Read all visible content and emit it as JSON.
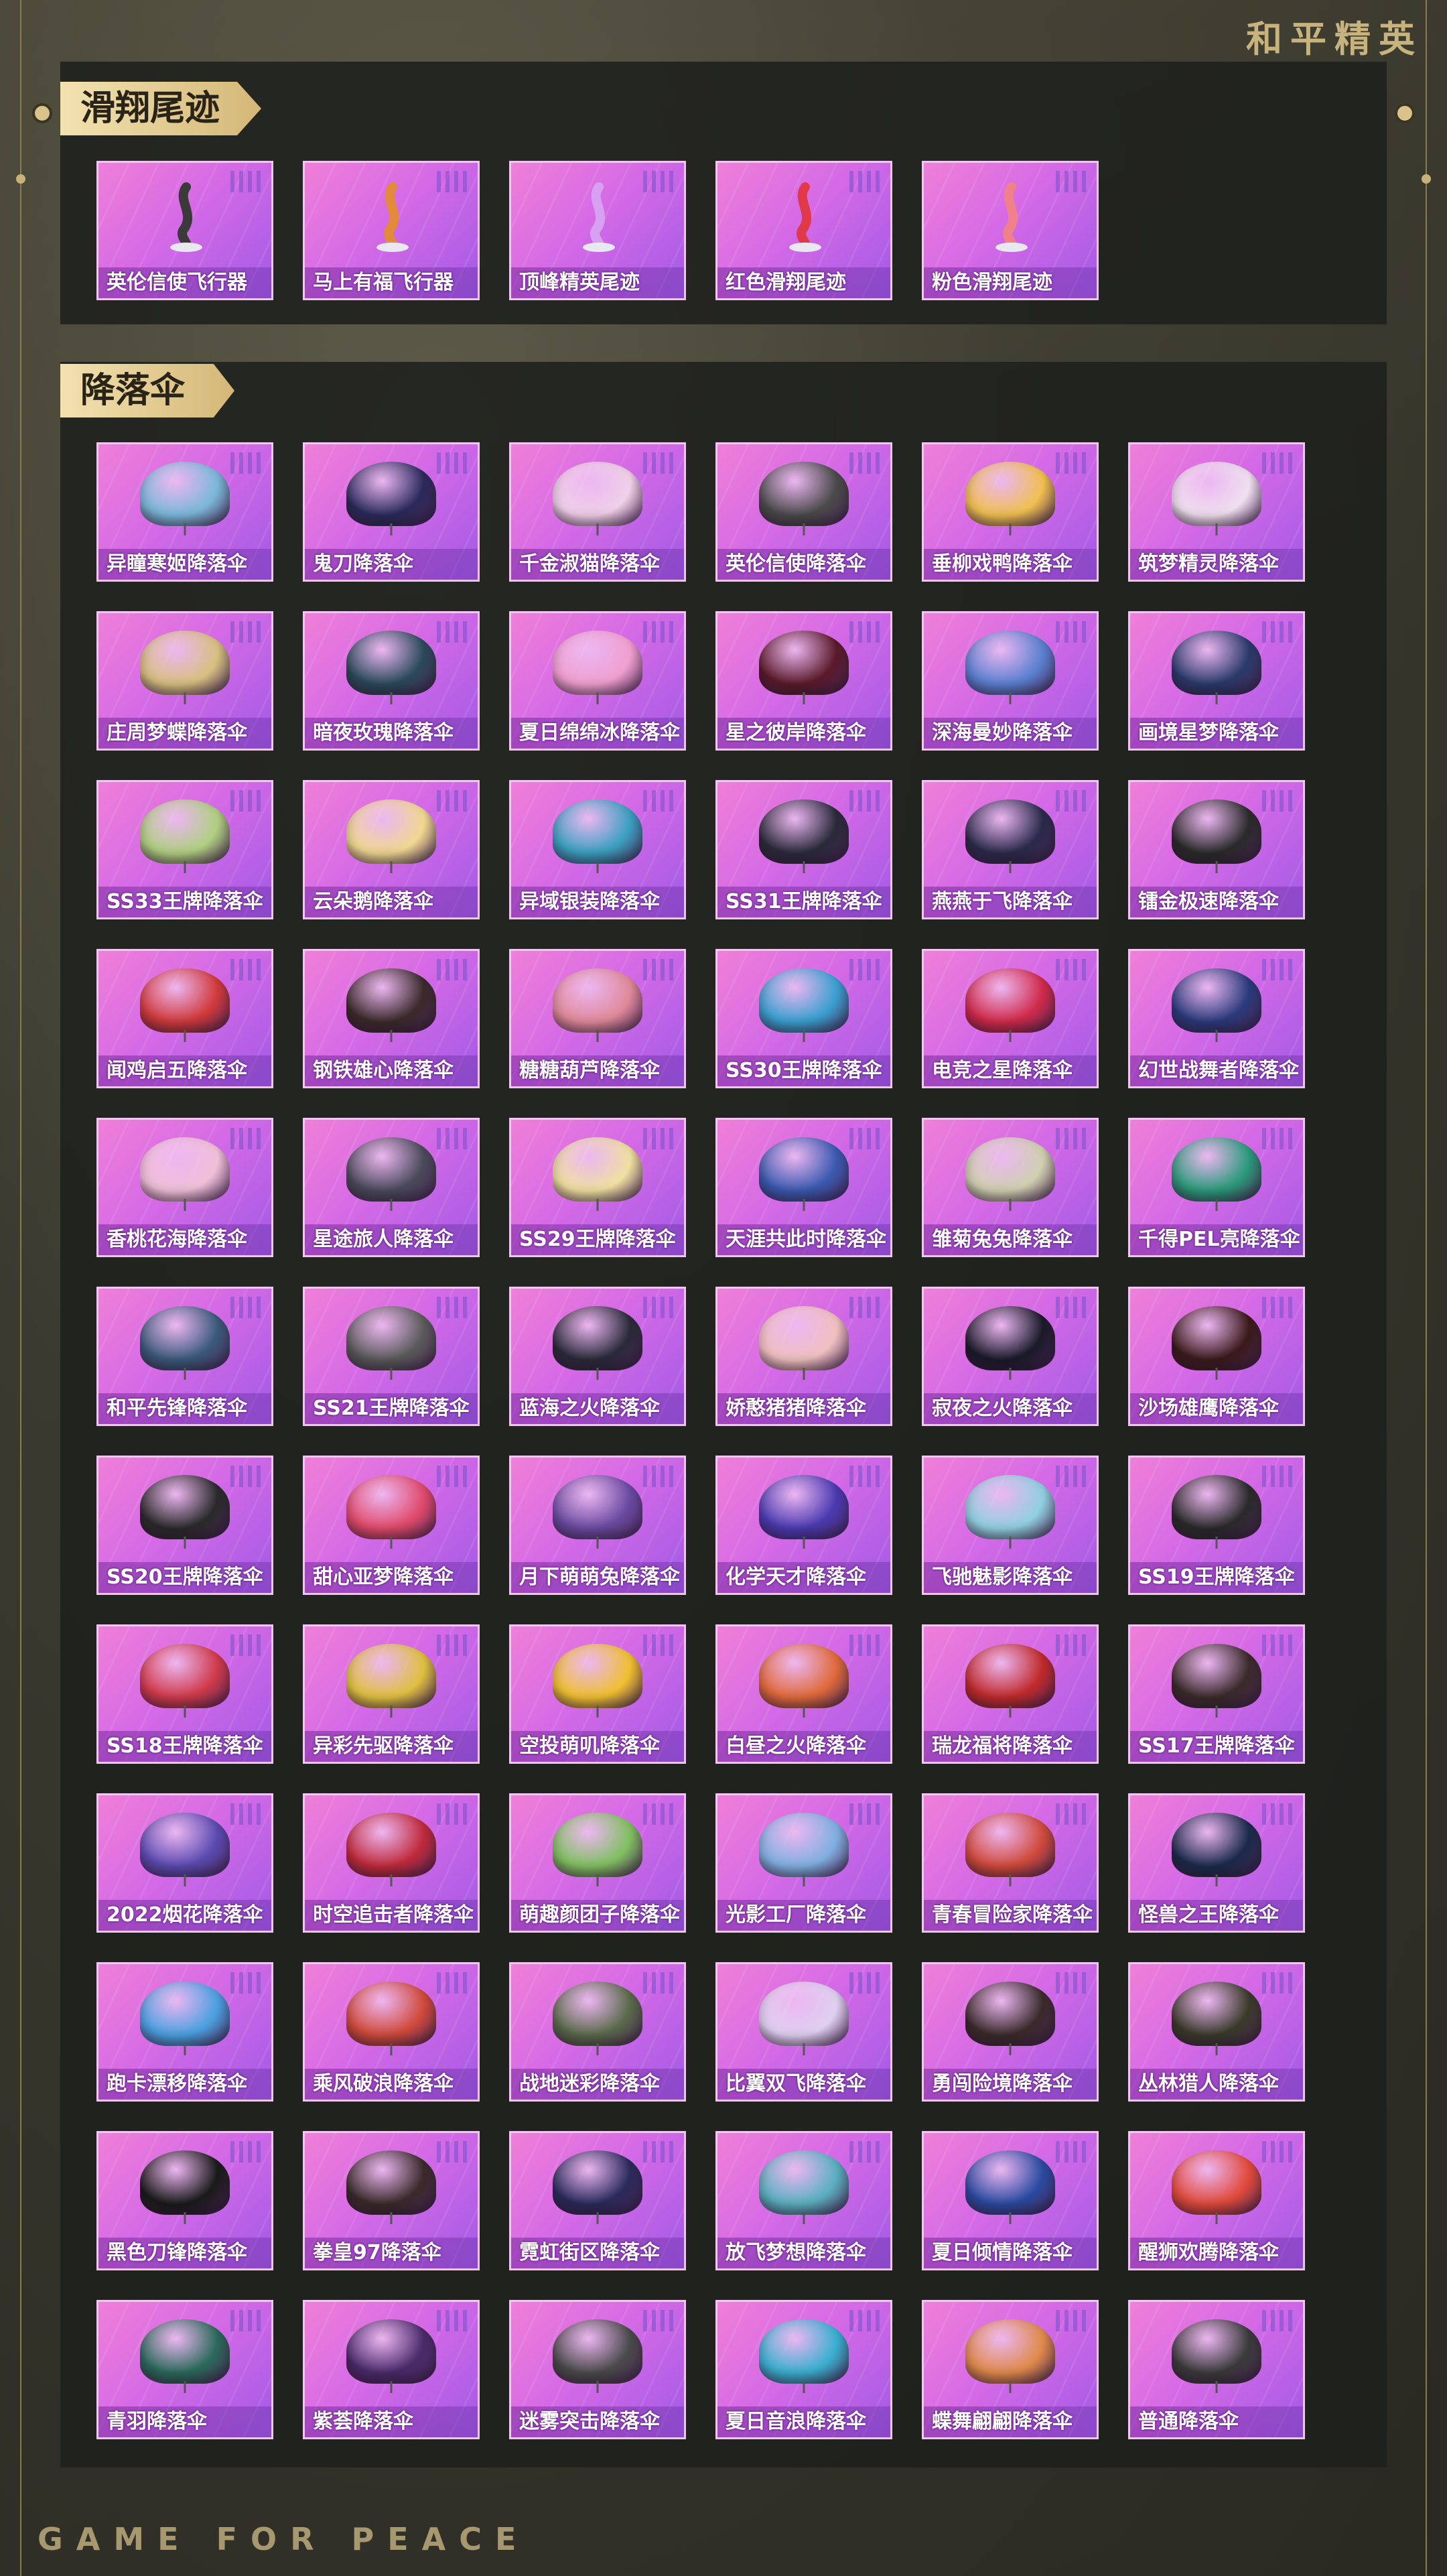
{
  "brand": "和平精英",
  "footer": "GAME FOR PEACE",
  "sections": {
    "trails": {
      "title": "滑翔尾迹",
      "items": [
        {
          "label": "英伦信使飞行器",
          "color": "#3a3a3a"
        },
        {
          "label": "马上有福飞行器",
          "color": "#e08a3a"
        },
        {
          "label": "顶峰精英尾迹",
          "color": "#d8a0f0"
        },
        {
          "label": "红色滑翔尾迹",
          "color": "#e03a4a"
        },
        {
          "label": "粉色滑翔尾迹",
          "color": "#f0808a"
        }
      ]
    },
    "parachutes": {
      "title": "降落伞",
      "items": [
        {
          "label": "异瞳寒姬降落伞",
          "color": "#7ab8d8"
        },
        {
          "label": "鬼刀降落伞",
          "color": "#2a2a5a"
        },
        {
          "label": "千金淑猫降落伞",
          "color": "#f0d0e8"
        },
        {
          "label": "英伦信使降落伞",
          "color": "#4a4a4a"
        },
        {
          "label": "垂柳戏鸭降落伞",
          "color": "#f0c050"
        },
        {
          "label": "筑梦精灵降落伞",
          "color": "#f0e0f0"
        },
        {
          "label": "庄周梦蝶降落伞",
          "color": "#d8c080"
        },
        {
          "label": "暗夜玫瑰降落伞",
          "color": "#2a4a5a"
        },
        {
          "label": "夏日绵绵冰降落伞",
          "color": "#f0a0d0"
        },
        {
          "label": "星之彼岸降落伞",
          "color": "#5a1a2a"
        },
        {
          "label": "深海曼妙降落伞",
          "color": "#5a80d0"
        },
        {
          "label": "画境星梦降落伞",
          "color": "#2a3a6a"
        },
        {
          "label": "SS33王牌降落伞",
          "color": "#b0d080"
        },
        {
          "label": "云朵鹅降落伞",
          "color": "#f0d890"
        },
        {
          "label": "异域银装降落伞",
          "color": "#3aa0c0"
        },
        {
          "label": "SS31王牌降落伞",
          "color": "#2a2a3a"
        },
        {
          "label": "燕燕于飞降落伞",
          "color": "#2a2a4a"
        },
        {
          "label": "镭金极速降落伞",
          "color": "#2a2a2a"
        },
        {
          "label": "闻鸡启五降落伞",
          "color": "#d03a3a"
        },
        {
          "label": "钢铁雄心降落伞",
          "color": "#3a2a2a"
        },
        {
          "label": "糖糖葫芦降落伞",
          "color": "#e08a9a"
        },
        {
          "label": "SS30王牌降落伞",
          "color": "#3aa0d0"
        },
        {
          "label": "电竞之星降落伞",
          "color": "#d02a4a"
        },
        {
          "label": "幻世战舞者降落伞",
          "color": "#2a3a7a"
        },
        {
          "label": "香桃花海降落伞",
          "color": "#f0c0d8"
        },
        {
          "label": "星途旅人降落伞",
          "color": "#4a4a5a"
        },
        {
          "label": "SS29王牌降落伞",
          "color": "#f0e0a0"
        },
        {
          "label": "天涯共此时降落伞",
          "color": "#3a5ab0"
        },
        {
          "label": "雏菊兔兔降落伞",
          "color": "#d0d0b0"
        },
        {
          "label": "千得PEL亮降落伞",
          "color": "#2a9a7a"
        },
        {
          "label": "和平先锋降落伞",
          "color": "#3a5a7a"
        },
        {
          "label": "SS21王牌降落伞",
          "color": "#5a5a5a"
        },
        {
          "label": "蓝海之火降落伞",
          "color": "#2a2a3a"
        },
        {
          "label": "娇憨猪猪降落伞",
          "color": "#f0c0c0"
        },
        {
          "label": "寂夜之火降落伞",
          "color": "#1a1a2a"
        },
        {
          "label": "沙场雄鹰降落伞",
          "color": "#3a1a1a"
        },
        {
          "label": "SS20王牌降落伞",
          "color": "#2a2a2a"
        },
        {
          "label": "甜心亚梦降落伞",
          "color": "#e04a6a"
        },
        {
          "label": "月下萌萌兔降落伞",
          "color": "#6a4aa0"
        },
        {
          "label": "化学天才降落伞",
          "color": "#4a3ab0"
        },
        {
          "label": "飞驰魅影降落伞",
          "color": "#90d0e0"
        },
        {
          "label": "SS19王牌降落伞",
          "color": "#2a2a2a"
        },
        {
          "label": "SS18王牌降落伞",
          "color": "#d03a4a"
        },
        {
          "label": "异彩先驱降落伞",
          "color": "#e0c040"
        },
        {
          "label": "空投萌叽降落伞",
          "color": "#f0c030"
        },
        {
          "label": "白昼之火降落伞",
          "color": "#e06a3a"
        },
        {
          "label": "瑞龙福将降落伞",
          "color": "#c02a2a"
        },
        {
          "label": "SS17王牌降落伞",
          "color": "#3a2a2a"
        },
        {
          "label": "2022烟花降落伞",
          "color": "#5a4ab0"
        },
        {
          "label": "时空追击者降落伞",
          "color": "#c02a3a"
        },
        {
          "label": "萌趣颜团子降落伞",
          "color": "#80c060"
        },
        {
          "label": "光影工厂降落伞",
          "color": "#80b0e0"
        },
        {
          "label": "青春冒险家降落伞",
          "color": "#d04a3a"
        },
        {
          "label": "怪兽之王降落伞",
          "color": "#1a2a4a"
        },
        {
          "label": "跑卡漂移降落伞",
          "color": "#4aa0e0"
        },
        {
          "label": "乘风破浪降落伞",
          "color": "#d04a3a"
        },
        {
          "label": "战地迷彩降落伞",
          "color": "#5a6a4a"
        },
        {
          "label": "比翼双飞降落伞",
          "color": "#e0d0f0"
        },
        {
          "label": "勇闯险境降落伞",
          "color": "#3a2a2a"
        },
        {
          "label": "丛林猎人降落伞",
          "color": "#3a3a2a"
        },
        {
          "label": "黑色刀锋降落伞",
          "color": "#1a1a1a"
        },
        {
          "label": "拳皇97降落伞",
          "color": "#3a2a2a"
        },
        {
          "label": "霓虹街区降落伞",
          "color": "#2a2a5a"
        },
        {
          "label": "放飞梦想降落伞",
          "color": "#5ab0c0"
        },
        {
          "label": "夏日倾情降落伞",
          "color": "#2a4aa0"
        },
        {
          "label": "醒狮欢腾降落伞",
          "color": "#e04a3a"
        },
        {
          "label": "青羽降落伞",
          "color": "#2a6a5a"
        },
        {
          "label": "紫荟降落伞",
          "color": "#4a2a6a"
        },
        {
          "label": "迷雾突击降落伞",
          "color": "#4a4a4a"
        },
        {
          "label": "夏日音浪降落伞",
          "color": "#3ab0d0"
        },
        {
          "label": "蝶舞翩翩降落伞",
          "color": "#e08a4a"
        },
        {
          "label": "普通降落伞",
          "color": "#3a3a3a"
        }
      ]
    }
  }
}
